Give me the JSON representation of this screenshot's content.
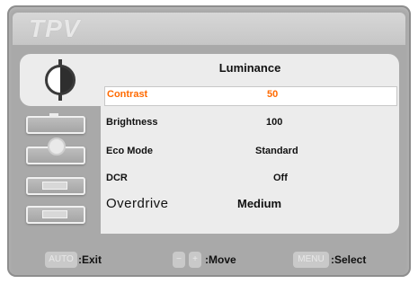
{
  "brand": "TPV",
  "menu": {
    "title": "Luminance",
    "rows": [
      {
        "label": "Contrast",
        "value": "50"
      },
      {
        "label": "Brightness",
        "value": "100"
      },
      {
        "label": "Eco Mode",
        "value": "Standard"
      },
      {
        "label": "DCR",
        "value": "Off"
      },
      {
        "label": "Overdrive",
        "value": "Medium"
      }
    ]
  },
  "tabs": [
    {
      "icon": "luminance-icon"
    },
    {
      "icon": "image-setup-icon"
    },
    {
      "icon": "color-temp-icon"
    },
    {
      "icon": "picture-boost-icon"
    },
    {
      "icon": "osd-setup-icon"
    }
  ],
  "footer": {
    "auto_key": "AUTO",
    "exit_label": ":Exit",
    "move_label": ":Move",
    "menu_key": "MENU",
    "select_label": ":Select"
  },
  "colors": {
    "selected_text": "#ff6a00",
    "panel": "#ececec",
    "bezel": "#a9a9a9"
  }
}
